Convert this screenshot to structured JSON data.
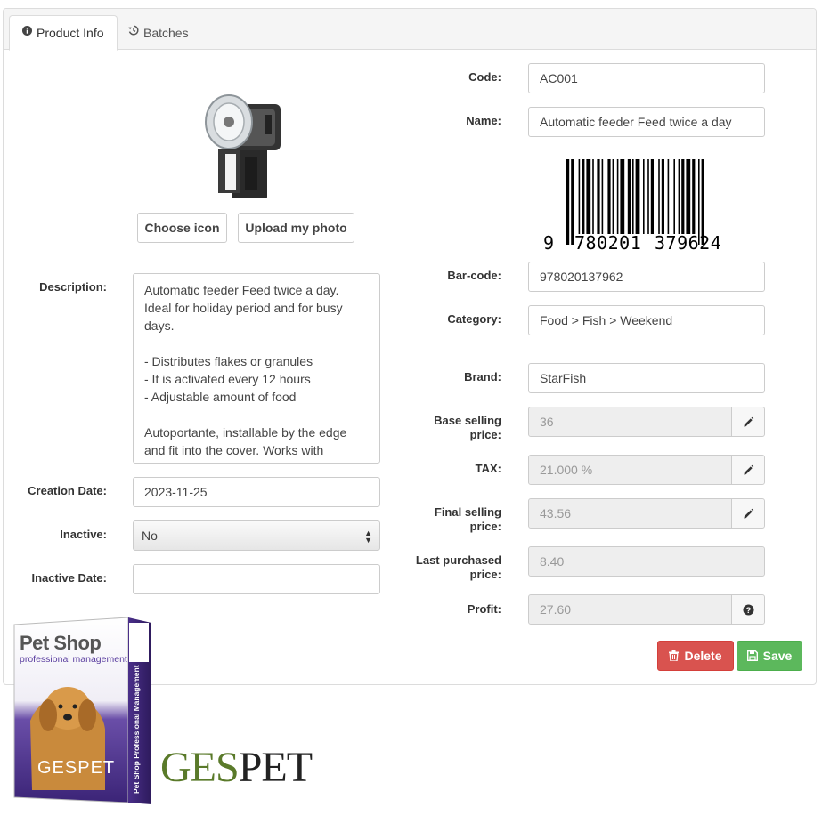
{
  "tabs": [
    {
      "label": "Product Info",
      "icon": "info-circle-icon",
      "active": true
    },
    {
      "label": "Batches",
      "icon": "history-icon",
      "active": false
    }
  ],
  "photo_buttons": {
    "choose_icon": "Choose icon",
    "upload_photo": "Upload my photo"
  },
  "fields": {
    "code": {
      "label": "Code:",
      "value": "AC001"
    },
    "name": {
      "label": "Name:",
      "value": "Automatic feeder Feed twice a day"
    },
    "barcode_image": {
      "first_digit": "9",
      "left_group": "780201",
      "right_group": "379624"
    },
    "barcode": {
      "label": "Bar-code:",
      "value": "978020137962"
    },
    "category": {
      "label": "Category:",
      "value": "Food > Fish > Weekend"
    },
    "brand": {
      "label": "Brand:",
      "value": "StarFish"
    },
    "base_price": {
      "label_line1": "Base selling",
      "label_line2": "price:",
      "value": "36"
    },
    "tax": {
      "label": "TAX:",
      "value": "21.000 %"
    },
    "final_price": {
      "label_line1": "Final selling",
      "label_line2": "price:",
      "value": "43.56"
    },
    "last_purchased": {
      "label_line1": "Last purchased",
      "label_line2": "price:",
      "value": "8.40"
    },
    "profit": {
      "label": "Profit:",
      "value": "27.60"
    },
    "description": {
      "label": "Description:",
      "value": "Automatic feeder Feed twice a day. Ideal for holiday period and for busy days.\n\n- Distributes flakes or granules\n- It is activated every 12 hours\n- Adjustable amount of food\n\nAutoportante, installable by the edge and fit into the cover. Works with batteries, not included)."
    },
    "creation_date": {
      "label": "Creation Date:",
      "value": "2023-11-25"
    },
    "inactive": {
      "label": "Inactive:",
      "value": "No"
    },
    "inactive_date": {
      "label": "Inactive Date:",
      "value": ""
    }
  },
  "actions": {
    "delete": "Delete",
    "save": "Save"
  },
  "branding": {
    "box_title": "Pet Shop",
    "box_subtitle": "professional management",
    "box_side_text": "Pet Shop Professional Management",
    "box_logo": "GESPET",
    "logo_text_left": "GES",
    "logo_text_right": "PET"
  },
  "colors": {
    "danger": "#d9534f",
    "success": "#5cb85c",
    "box_purple": "#4a2f8a",
    "logo_green": "#5a7a2a"
  }
}
